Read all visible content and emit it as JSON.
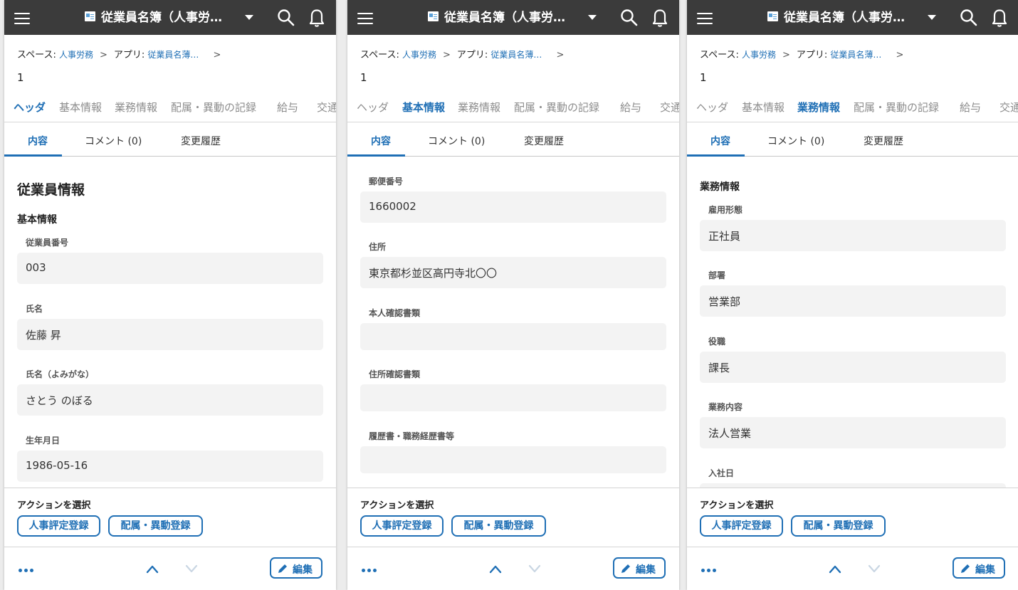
{
  "colors": {
    "topbar": "#3b3b3b",
    "accent": "#1f6fb5",
    "field_bg": "#f3f3f3"
  },
  "header": {
    "app_title": "従業員名簿（人事労…"
  },
  "breadcrumb": {
    "space_label": "スペース:",
    "space_link": "人事労務",
    "app_label": "アプリ:",
    "app_link": "従業員名薄…",
    "sep": ">"
  },
  "record_number": "1",
  "section_tabs": [
    "ヘッダ",
    "基本情報",
    "業務情報",
    "配属・異動の記録",
    "給与",
    "交通"
  ],
  "sub_tabs": [
    "内容",
    "コメント (0)",
    "変更履歴"
  ],
  "actions": {
    "label": "アクションを選択",
    "buttons": [
      "人事評定登録",
      "配属・異動登録"
    ]
  },
  "bottom": {
    "edit_label": "編集"
  },
  "panels": [
    {
      "active_section": 0,
      "heading": "従業員情報",
      "subheading": "基本情報",
      "fields": [
        {
          "label": "従業員番号",
          "value": "003"
        },
        {
          "label": "氏名",
          "value": "佐藤 昇"
        },
        {
          "label": "氏名（よみがな）",
          "value": "さとう のぼる"
        },
        {
          "label": "生年月日",
          "value": "1986-05-16"
        }
      ]
    },
    {
      "active_section": 1,
      "fields": [
        {
          "label": "郵便番号",
          "value": "1660002"
        },
        {
          "label": "住所",
          "value": "東京都杉並区高円寺北〇〇"
        },
        {
          "label": "本人確認書類",
          "value": ""
        },
        {
          "label": "住所確認書類",
          "value": ""
        },
        {
          "label": "履歴書・職務経歴書等",
          "value": ""
        }
      ]
    },
    {
      "active_section": 2,
      "subheading": "業務情報",
      "fields": [
        {
          "label": "雇用形態",
          "value": "正社員"
        },
        {
          "label": "部署",
          "value": "営業部"
        },
        {
          "label": "役職",
          "value": "課長"
        },
        {
          "label": "業務内容",
          "value": "法人営業"
        },
        {
          "label": "入社日",
          "value": ""
        }
      ]
    }
  ]
}
